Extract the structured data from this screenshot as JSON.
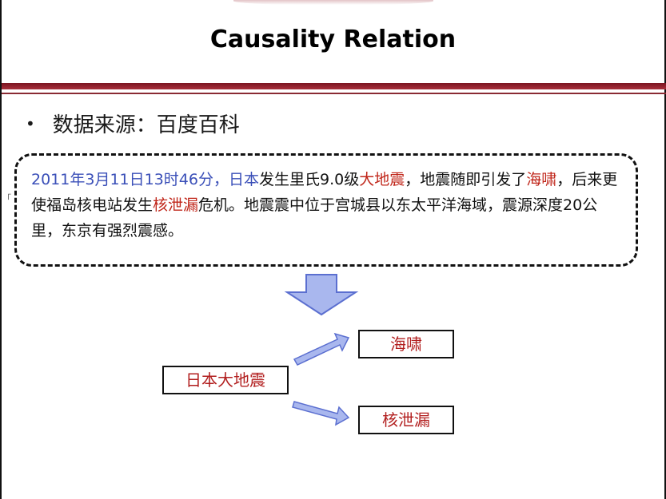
{
  "title": "Causality Relation",
  "bullet": "数据来源：百度百科",
  "side_mark": "「",
  "paragraph": [
    {
      "text": "2011年3月11日13时46分，日本",
      "color": "#3a4fb8"
    },
    {
      "text": "发生里氏9.0级",
      "color": "#111111"
    },
    {
      "text": "大地震",
      "color": "#c0261a"
    },
    {
      "text": "，地震随即引发了",
      "color": "#111111"
    },
    {
      "text": "海啸",
      "color": "#c0261a"
    },
    {
      "text": "，后来更使福岛核电站发生",
      "color": "#111111"
    },
    {
      "text": "核泄漏",
      "color": "#c0261a"
    },
    {
      "text": "危机。地震震中位于宫城县以东太平洋海域，震源深度20公里，东京有强烈震感。",
      "color": "#111111"
    }
  ],
  "diagram": {
    "cause": "日本大地震",
    "effects": [
      "海啸",
      "核泄漏"
    ]
  },
  "colors": {
    "accent_red": "#8a2a33",
    "arrow_fill": "#a9b7ee",
    "arrow_stroke": "#5b6fd0"
  }
}
